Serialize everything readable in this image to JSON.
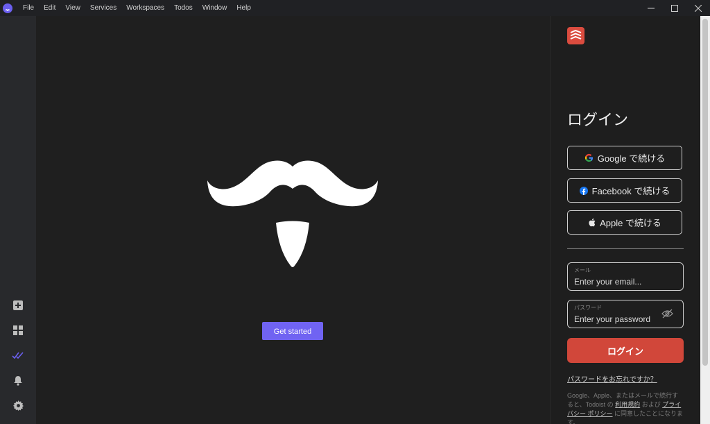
{
  "titlebar": {
    "menu": [
      "File",
      "Edit",
      "View",
      "Services",
      "Workspaces",
      "Todos",
      "Window",
      "Help"
    ],
    "controls": {
      "minimize_icon": "minimize-icon",
      "maximize_icon": "maximize-icon",
      "close_icon": "close-icon"
    }
  },
  "rail": {
    "icons": [
      "add-workspace-icon",
      "workspaces-grid-icon",
      "todos-icon",
      "notifications-icon",
      "settings-icon"
    ],
    "accent": "#6b5ff0"
  },
  "main": {
    "get_started_label": "Get started",
    "accent": "#7063f2"
  },
  "login": {
    "heading": "ログイン",
    "google_label": "Google で続ける",
    "facebook_label": "Facebook で続ける",
    "apple_label": "Apple で続ける",
    "email_label": "メール",
    "email_placeholder": "Enter your email...",
    "password_label": "パスワード",
    "password_placeholder": "Enter your password",
    "submit_label": "ログイン",
    "forgot_label": "パスワードをお忘れですか？",
    "legal": {
      "text1": "Google、Apple、またはメールで続行すると、Todoist の ",
      "terms_link": "利用規約",
      "text2": " および ",
      "privacy_link": "プライバシー ポリシー",
      "text3": " に同意したことになります。"
    },
    "brand_color": "#db4c3f"
  }
}
